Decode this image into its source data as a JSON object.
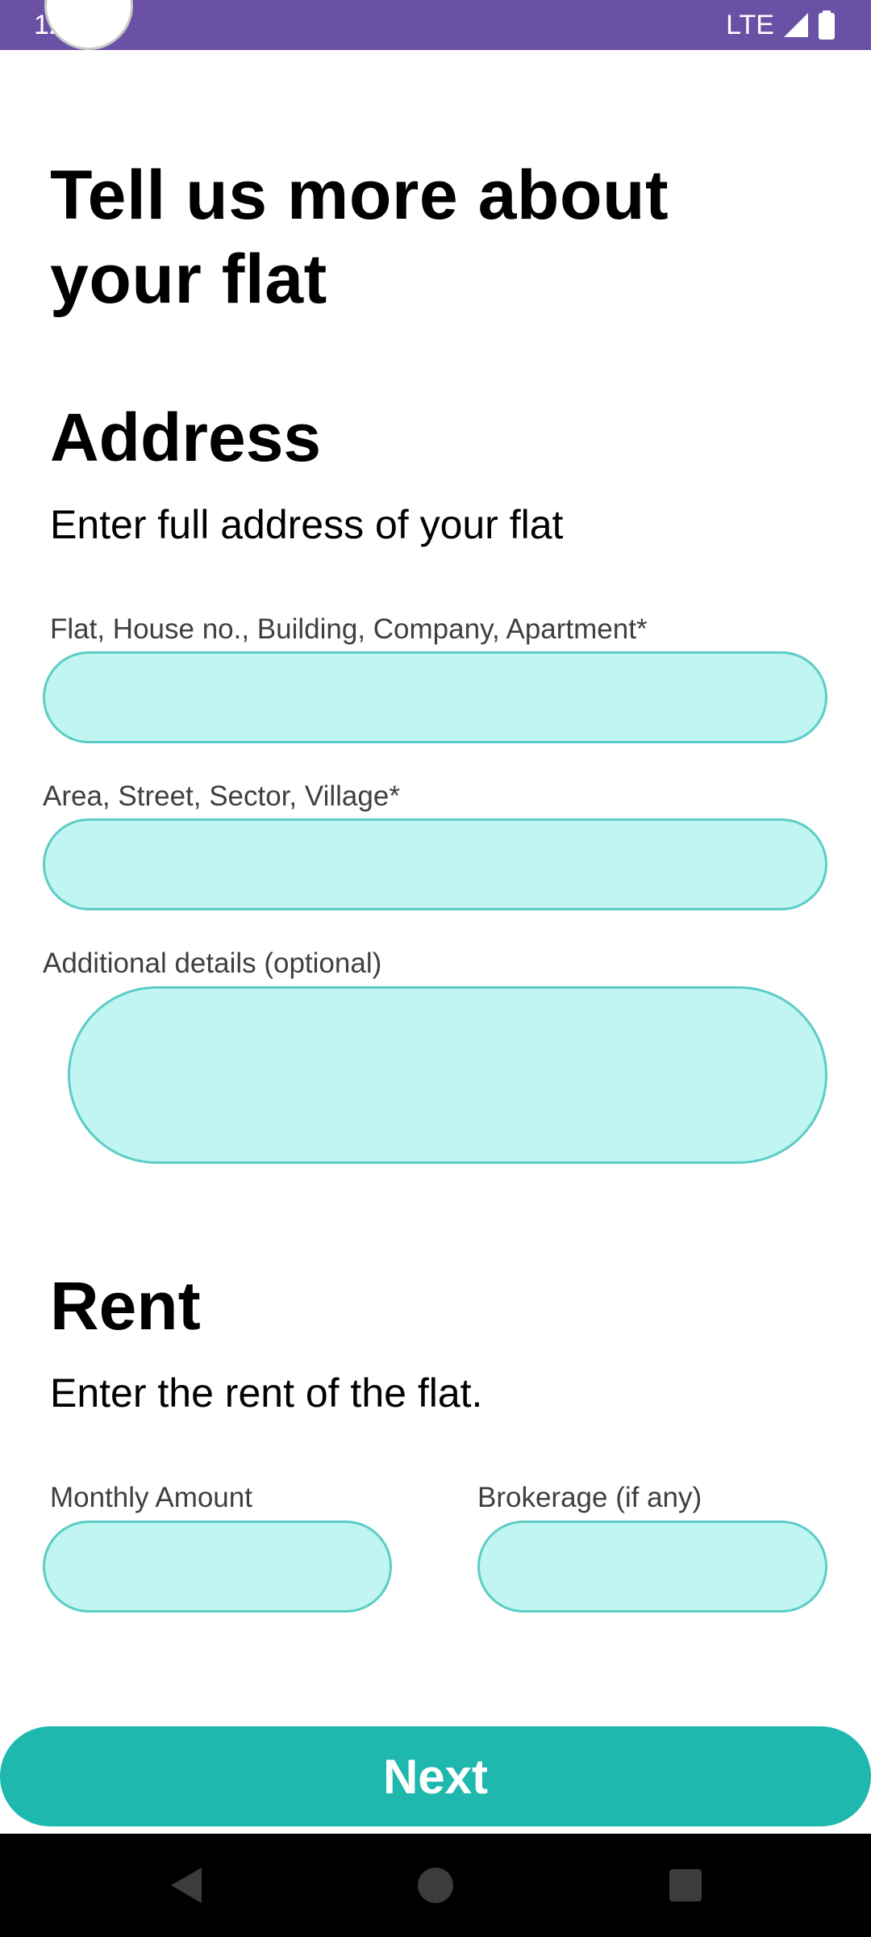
{
  "status_bar": {
    "time": "12:53",
    "network": "LTE"
  },
  "page": {
    "title": "Tell us more about your flat"
  },
  "address": {
    "heading": "Address",
    "subtitle": "Enter full address of your flat",
    "field1_label": "Flat, House no., Building, Company, Apartment*",
    "field1_value": "",
    "field2_label": "Area, Street, Sector, Village*",
    "field2_value": "",
    "field3_label": "Additional details (optional)",
    "field3_value": ""
  },
  "rent": {
    "heading": "Rent",
    "subtitle": "Enter the rent of the flat.",
    "monthly_label": "Monthly Amount",
    "monthly_value": "",
    "brokerage_label": "Brokerage (if any)",
    "brokerage_value": ""
  },
  "actions": {
    "next_label": "Next"
  },
  "colors": {
    "status_bar": "#6a51a6",
    "input_fill": "#c0f5f2",
    "input_border": "#5ccdc6",
    "primary_button": "#1fb8ae"
  },
  "icons": {
    "signal": "signal-icon",
    "battery": "battery-icon",
    "back": "back-icon",
    "home": "home-icon",
    "recents": "recents-icon"
  }
}
